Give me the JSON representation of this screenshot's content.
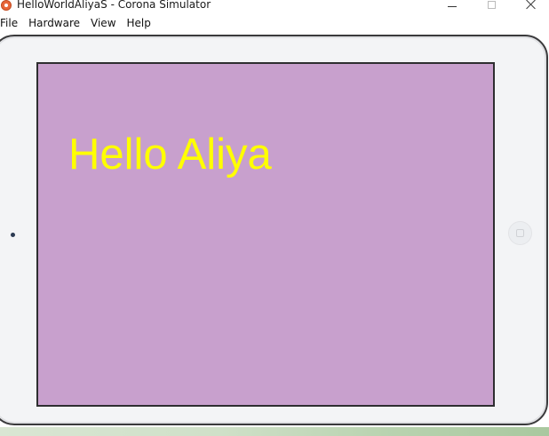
{
  "window": {
    "title": "HelloWorldAliyaS - Corona Simulator",
    "app_icon": "corona-logo-icon",
    "controls": {
      "minimize_icon": "minimize-icon",
      "maximize_icon": "maximize-icon",
      "close_icon": "close-icon"
    }
  },
  "menu": {
    "items": [
      {
        "label": "File"
      },
      {
        "label": "Hardware"
      },
      {
        "label": "View"
      },
      {
        "label": "Help"
      }
    ]
  },
  "device": {
    "type": "iPad",
    "orientation": "landscape",
    "screen_background": "#c8a0cd",
    "camera_icon": "camera-icon",
    "home_button_icon": "home-button-icon"
  },
  "app_screen": {
    "text": "Hello Aliya",
    "text_color": "#ffff00"
  }
}
